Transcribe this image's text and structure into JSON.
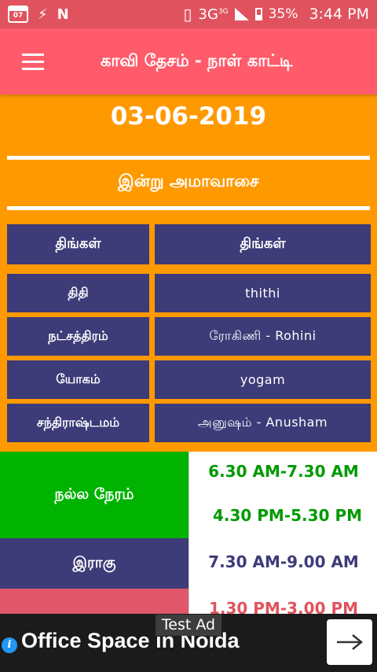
{
  "status_bar": {
    "calendar_text": "07",
    "network": "3G",
    "network_sup": "3G",
    "battery": "35%",
    "time": "3:44 PM"
  },
  "app_bar": {
    "title": "காவி தேசம் - நாள் காட்டி"
  },
  "date": "03-06-2019",
  "today_note": "இன்று அமாவாசை",
  "panchang": {
    "header": {
      "label": "திங்கள்",
      "value": "திங்கள்"
    },
    "rows": [
      {
        "label": "திதி",
        "value": "thithi"
      },
      {
        "label": "நட்சத்திரம்",
        "value": "ரோகிணி - Rohini"
      },
      {
        "label": "யோகம்",
        "value": "yogam"
      },
      {
        "label": "சந்திராஷ்டமம்",
        "value": "அனுஷம் - Anusham"
      }
    ]
  },
  "timings": [
    {
      "label": "நல்ல நேரம்",
      "values": [
        "6.30 AM-7.30 AM",
        "4.30 PM-5.30 PM"
      ],
      "color": "#009a00",
      "label_bg": "#00b300"
    },
    {
      "label": "இராகு",
      "values": [
        "7.30 AM-9.00 AM"
      ],
      "color": "#3d3b78",
      "label_bg": "#3d3b78"
    },
    {
      "label": "",
      "values": [
        "1.30 PM-3.00 PM"
      ],
      "color": "#e0535e",
      "label_bg": "#e0576a"
    }
  ],
  "ad": {
    "label": "Test Ad",
    "text": "Office Space in Noida"
  }
}
